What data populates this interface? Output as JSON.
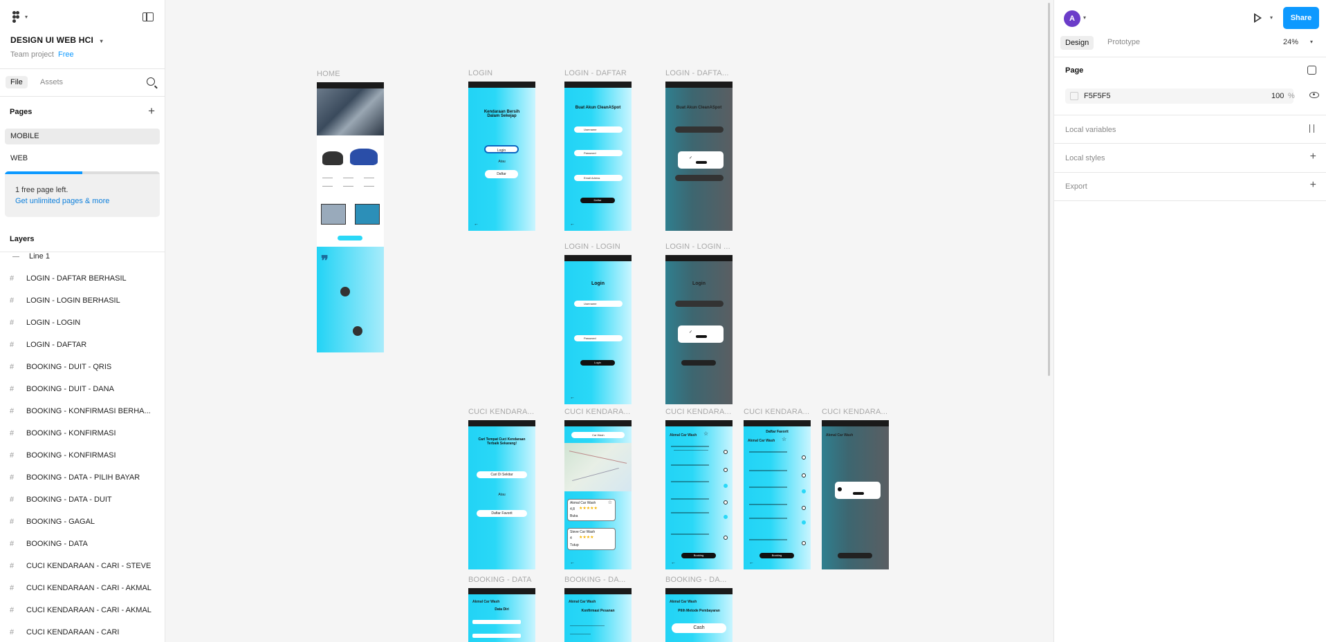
{
  "app": {
    "project_title": "DESIGN UI WEB HCI",
    "project_sub": "Team project",
    "plan_badge": "Free"
  },
  "left_panel": {
    "tabs": {
      "file": "File",
      "assets": "Assets"
    },
    "pages_header": "Pages",
    "pages": [
      {
        "label": "MOBILE",
        "selected": true
      },
      {
        "label": "WEB",
        "selected": false
      }
    ],
    "page_notice": {
      "line1": "1 free page left.",
      "link": "Get unlimited pages & more",
      "progress": 0.5
    },
    "layers_header": "Layers",
    "layers": [
      {
        "label": "Line 1",
        "kind": "line"
      },
      {
        "label": "LOGIN - DAFTAR BERHASIL",
        "kind": "frame"
      },
      {
        "label": "LOGIN - LOGIN BERHASIL",
        "kind": "frame"
      },
      {
        "label": "LOGIN - LOGIN",
        "kind": "frame"
      },
      {
        "label": "LOGIN - DAFTAR",
        "kind": "frame"
      },
      {
        "label": "BOOKING - DUIT - QRIS",
        "kind": "frame"
      },
      {
        "label": "BOOKING - DUIT - DANA",
        "kind": "frame"
      },
      {
        "label": "BOOKING - KONFIRMASI BERHA...",
        "kind": "frame"
      },
      {
        "label": "BOOKING - KONFIRMASI",
        "kind": "frame"
      },
      {
        "label": "BOOKING - KONFIRMASI",
        "kind": "frame"
      },
      {
        "label": "BOOKING - DATA - PILIH BAYAR",
        "kind": "frame"
      },
      {
        "label": "BOOKING - DATA - DUIT",
        "kind": "frame"
      },
      {
        "label": "BOOKING - GAGAL",
        "kind": "frame"
      },
      {
        "label": "BOOKING - DATA",
        "kind": "frame"
      },
      {
        "label": "CUCI KENDARAAN - CARI - STEVE",
        "kind": "frame"
      },
      {
        "label": "CUCI KENDARAAN - CARI - AKMAL",
        "kind": "frame"
      },
      {
        "label": "CUCI KENDARAAN - CARI - AKMAL",
        "kind": "frame"
      },
      {
        "label": "CUCI KENDARAAN - CARI",
        "kind": "frame"
      }
    ]
  },
  "right_panel": {
    "avatar_letter": "A",
    "share_label": "Share",
    "tabs": {
      "design": "Design",
      "prototype": "Prototype"
    },
    "zoom": "24%",
    "page_section": "Page",
    "page_color": "F5F5F5",
    "page_opacity": "100",
    "page_opacity_unit": "%",
    "local_variables": "Local variables",
    "local_styles": "Local styles",
    "export": "Export"
  },
  "canvas": {
    "frame_labels": {
      "home": "HOME",
      "login": "LOGIN",
      "login_daftar": "LOGIN - DAFTAR",
      "login_daftar_ok": "LOGIN - DAFTA...",
      "login_login": "LOGIN - LOGIN",
      "login_login_ok": "LOGIN - LOGIN ...",
      "cuci_1": "CUCI KENDARA...",
      "cuci_2": "CUCI KENDARA...",
      "cuci_3": "CUCI KENDARA...",
      "cuci_4": "CUCI KENDARA...",
      "cuci_5": "CUCI KENDARA...",
      "booking_data": "BOOKING - DATA",
      "booking_da_1": "BOOKING - DA...",
      "booking_da_2": "BOOKING - DA..."
    },
    "texts": {
      "login_heading": "Kendaraan Bersih Dalam Sekejap",
      "login_btn": "Login",
      "atau": "Atau",
      "daftar_btn": "Daftar",
      "daftar_heading": "Buat Akun CleanASpot",
      "username": "Username",
      "password": "Password",
      "email": "Email Adress",
      "daftar_submit": "Daftar",
      "login_heading2": "Login",
      "login_submit": "Login",
      "cari_heading": "Cari Tempat Cuci Kendaraan Terbaik Sekarang!",
      "cari_btn": "Cari Di Sekitar",
      "favorit_btn": "Daftar Favorit",
      "search_value": "Car Wash",
      "card1_name": "Akmal Car Wash",
      "card1_rating": "4,8",
      "card1_status": "Buka",
      "card2_name": "Steve Car Wash",
      "card2_rating": "4",
      "card2_status": "Tutup",
      "shop_name": "Akmal Car Wash",
      "favorit_heading": "Daftar Favorit",
      "booking_btn": "Booking",
      "data_heading": "Data Diri",
      "konfirmasi_heading": "Konfirmasi Pesanan",
      "bayar_heading": "Pilih Metode Pembayaran",
      "cash_btn": "Cash"
    }
  },
  "colors": {
    "accent": "#0d99ff",
    "canvas_bg": "#F5F5F5",
    "frame_cyan": "#22d3f5",
    "avatar": "#6b3cc9"
  }
}
